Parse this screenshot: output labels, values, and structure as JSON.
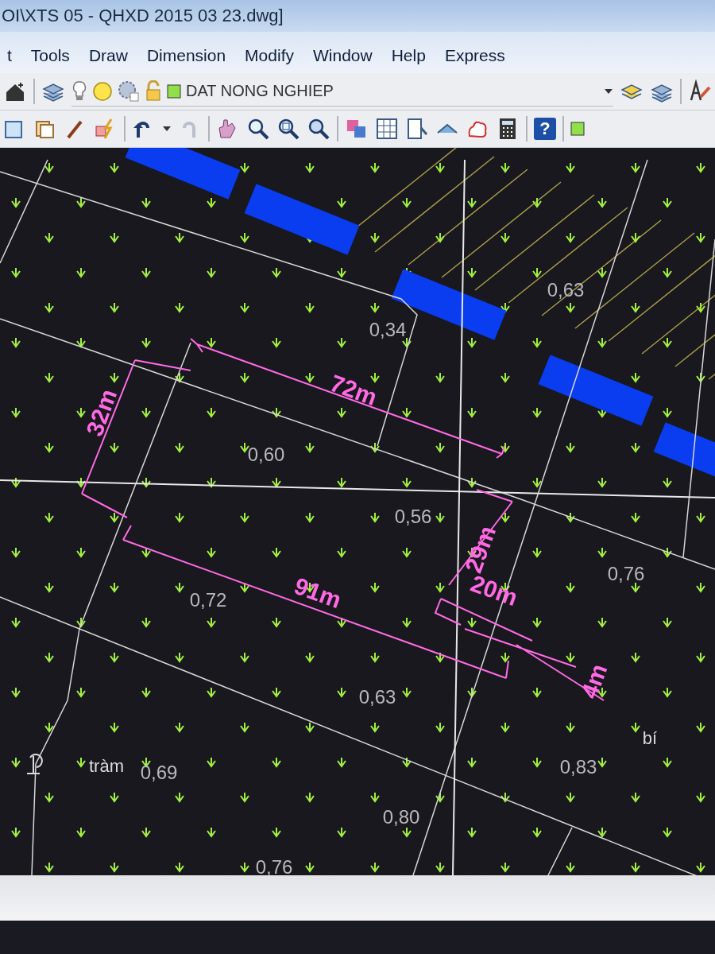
{
  "window": {
    "title": "OI\\XTS 05 - QHXD 2015 03 23.dwg]"
  },
  "menu": [
    "t",
    "Tools",
    "Draw",
    "Dimension",
    "Modify",
    "Window",
    "Help",
    "Express"
  ],
  "layer_toolbar": {
    "layer_name": "DAT NONG NGHIEP"
  },
  "standard_toolbar": {
    "help_label": "?"
  },
  "drawing": {
    "area_labels": [
      "0,63",
      "0,34",
      "0,60",
      "0,56",
      "0,76",
      "0,72",
      "0,63",
      "0,69",
      "0,83",
      "0,80",
      "0,76"
    ],
    "dimension_labels": [
      "72m",
      "32m",
      "91m",
      "29m",
      "20m",
      "4m"
    ],
    "notes": [
      "tràm",
      "bí"
    ]
  }
}
